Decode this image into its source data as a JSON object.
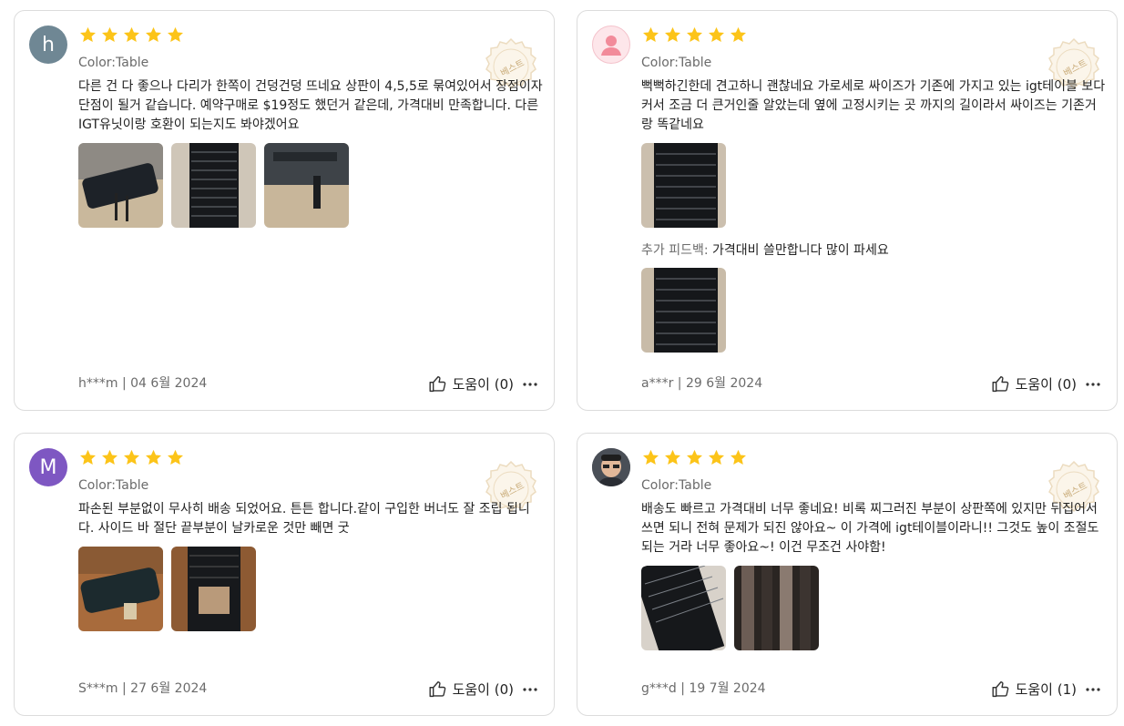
{
  "reviews": [
    {
      "avatar_letter": "h",
      "variant": "Color:Table",
      "text": "다른 건 다 좋으나 다리가 한쪽이 건덩건덩 뜨네요 상판이 4,5,5로 묶여있어서 장점이자 단점이 될거 같습니다. 예약구매로 $19정도 했던거 같은데, 가격대비 만족합니다. 다른 IGT유닛이랑 호환이 되는지도 봐야겠어요",
      "author": "h***m",
      "date": "04 6월 2024",
      "helpful": "도움이 (0)",
      "badge": "베스트"
    },
    {
      "avatar_letter": "",
      "variant": "Color:Table",
      "text": "뻑뻑하긴한데 견고하니 괜찮네요 가로세로 싸이즈가 기존에 가지고 있는 igt테이블 보다 커서 조금 더 큰거인줄 알았는데 옆에 고정시키는 곳 까지의 길이라서 싸이즈는 기존거랑 똑같네요",
      "followup_label": "추가 피드백:",
      "followup_text": "가격대비 쓸만합니다 많이 파세요",
      "author": "a***r",
      "date": "29 6월 2024",
      "helpful": "도움이 (0)",
      "badge": "베스트"
    },
    {
      "avatar_letter": "M",
      "variant": "Color:Table",
      "text": "파손된 부분없이 무사히 배송 되었어요. 튼튼 합니다.같이 구입한 버너도 잘 조립 됩니다. 사이드 바 절단 끝부분이 날카로운 것만 빼면 굿",
      "author": "S***m",
      "date": "27 6월 2024",
      "helpful": "도움이 (0)",
      "badge": "베스트"
    },
    {
      "avatar_letter": "",
      "variant": "Color:Table",
      "text": "배송도 빠르고 가격대비 너무 좋네요! 비록 찌그러진 부분이 상판쪽에 있지만 뒤집어서 쓰면 되니 전혀 문제가 되진 않아요~ 이 가격에 igt테이블이라니!! 그것도 높이 조절도 되는 거라 너무 좋아요~! 이건 무조건 사야함!",
      "author": "g***d",
      "date": "19 7월 2024",
      "helpful": "도움이 (1)",
      "badge": "베스트"
    }
  ],
  "colors": {
    "star": "#fcc419",
    "badge": "#e6cfa8"
  },
  "icons": {
    "star": "star-icon",
    "helpful": "thumbs-up-icon",
    "more": "more-options-icon",
    "badge": "best-review-badge-icon"
  }
}
